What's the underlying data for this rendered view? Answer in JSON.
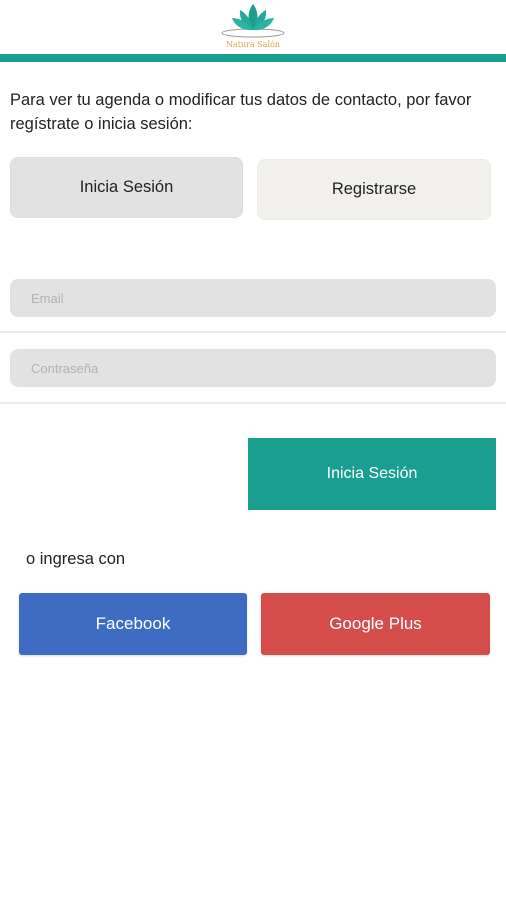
{
  "header": {
    "logo_icon": "lotus-icon",
    "brand_name": "Natura Salón",
    "accent_color": "#1a9e90"
  },
  "intro": {
    "text": "Para ver tu agenda o modificar tus datos de contacto, por favor regístrate o inicia sesión:"
  },
  "tabs": {
    "login_label": "Inicia Sesión",
    "register_label": "Registrarse"
  },
  "form": {
    "email_placeholder": "Email",
    "email_value": "",
    "password_placeholder": "Contraseña",
    "password_value": "",
    "submit_label": "Inicia Sesión"
  },
  "social": {
    "or_label": "o ingresa con",
    "facebook_label": "Facebook",
    "facebook_color": "#3e6cc2",
    "google_label": "Google Plus",
    "google_color": "#d44d4b"
  }
}
